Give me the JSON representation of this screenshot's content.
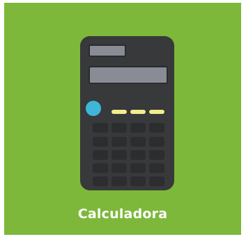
{
  "app": {
    "label": "Calculadora",
    "icon": "calculator-icon",
    "tile_color": "#7db83a"
  }
}
